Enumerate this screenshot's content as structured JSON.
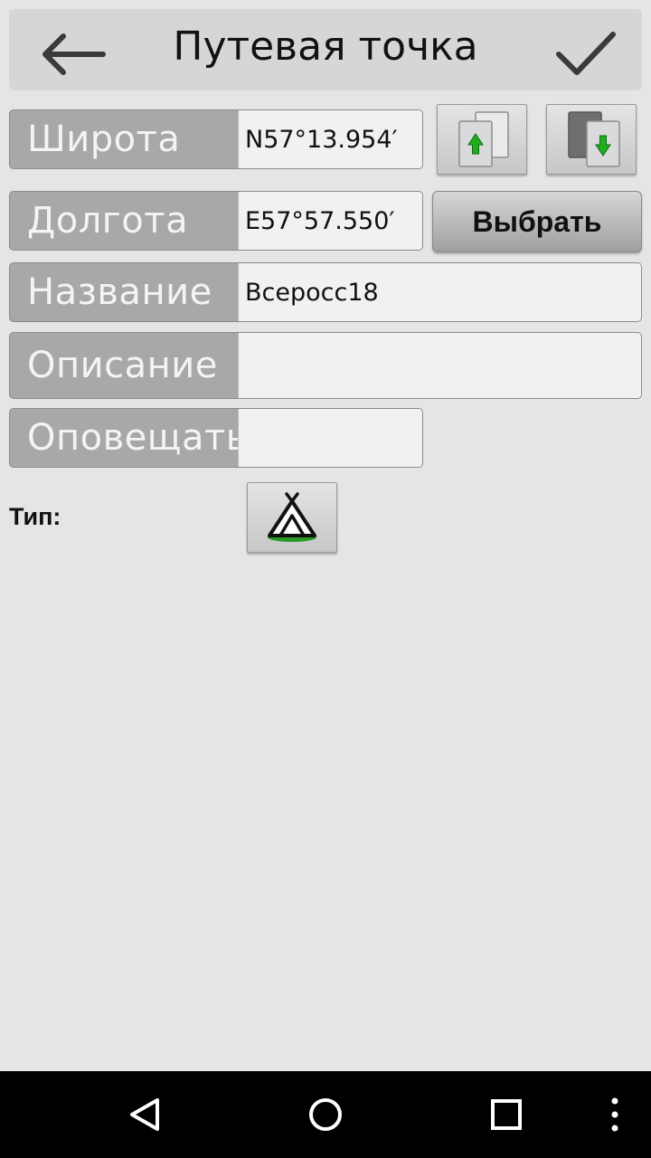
{
  "header": {
    "title": "Путевая точка",
    "back_icon": "arrow-left-icon",
    "confirm_icon": "checkmark-icon"
  },
  "form": {
    "latitude": {
      "label": "Широта",
      "value": "N57°13.954′"
    },
    "longitude": {
      "label": "Долгота",
      "value": "E57°57.550′"
    },
    "name": {
      "label": "Название",
      "value": "Всеросс18"
    },
    "description": {
      "label": "Описание",
      "value": ""
    },
    "notify": {
      "label": "Оповещать",
      "value": ""
    },
    "select_button": "Выбрать",
    "type_label": "Тип:"
  },
  "icons": {
    "upload": "copy-up-icon",
    "download": "paste-down-icon",
    "waypoint_type": "tent-icon"
  },
  "colors": {
    "background": "#e4e6e5",
    "label_bg": "#a7a8aa",
    "field_bg": "#f0f1f3",
    "arrow_green": "#1fae1f",
    "navbar": "#000000"
  },
  "navbar": {
    "back": "nav-back-icon",
    "home": "nav-home-icon",
    "recents": "nav-recents-icon",
    "menu": "overflow-menu-icon"
  }
}
